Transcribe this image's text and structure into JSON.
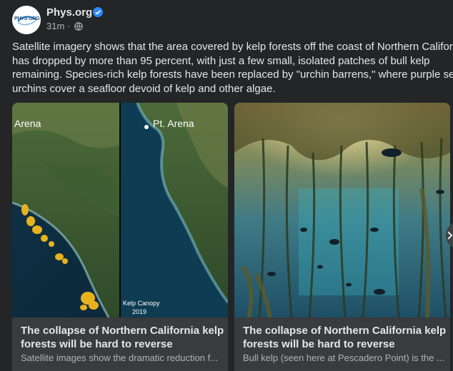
{
  "post": {
    "page_name": "Phys.org",
    "avatar_text": "PHYS ORG",
    "time": "31m",
    "text_lines": [
      "Satellite imagery shows that the area covered by kelp forests off the coast of Northern Califor",
      "has dropped by more than 95 percent, with just a few small, isolated patches of bull kelp",
      "remaining. Species-rich kelp forests have been replaced by \"urchin barrens,\" where purple sea",
      "urchins cover a seafloor devoid of kelp and other algae."
    ]
  },
  "cards": [
    {
      "title": "The collapse of Northern California kelp forests will be hard to reverse",
      "description": "Satellite images show the dramatic reduction f...",
      "image": {
        "left_label": "Arena",
        "right_label": "Pt. Arena",
        "caption_line1": "Kelp Canopy",
        "caption_line2": "2019"
      }
    },
    {
      "title": "The collapse of Northern California kelp forests will be hard to reverse",
      "description": "Bull kelp (seen here at Pescadero Point) is the ..."
    }
  ],
  "icons": {
    "verified": "verified-badge-icon",
    "audience": "globe-icon",
    "next": "chevron-right-icon"
  },
  "colors": {
    "background": "#242526",
    "card_background": "#3a3b3c",
    "verified": "#2d88ff",
    "text_secondary": "#b0b3b8"
  }
}
